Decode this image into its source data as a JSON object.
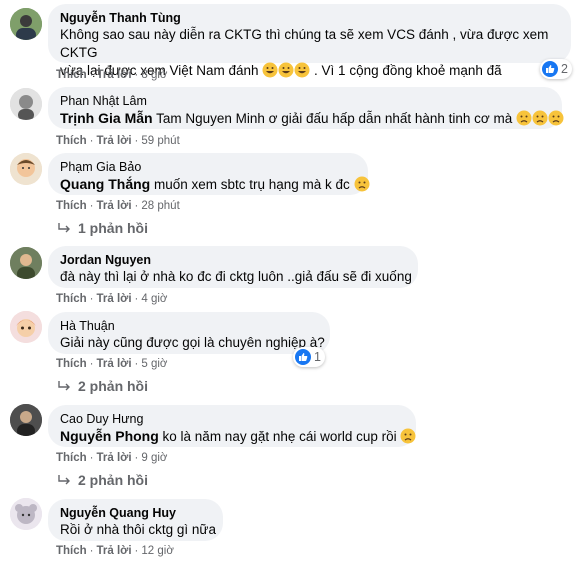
{
  "colors": {
    "bubble": "#f0f2f5",
    "meta": "#65676b",
    "like_blue": "#1877f2"
  },
  "actions": {
    "like": "Thích",
    "reply": "Trả lời"
  },
  "comments": [
    {
      "author": "Nguyễn Thanh Tùng",
      "line1": "Không sao sau này diễn ra CKTG thì chúng ta sẽ xem VCS đánh , vừa được xem CKTG",
      "line2": "vừa lại được xem Việt Nam đánh",
      "line2_after": " . Vì 1 cộng đồng khoẻ mạnh đã",
      "emojis": [
        "grinning",
        "grinning",
        "grinning"
      ],
      "time": "8 giờ",
      "reaction": {
        "icon": "like-icon",
        "count": "2"
      }
    },
    {
      "author": "Phan Nhật Lâm",
      "mention": "Trịnh Gia Mẫn",
      "text": " Tam Nguyen Minh ơ giải đấu hấp dẫn nhất hành tinh cơ mà",
      "emojis": [
        "sad",
        "sad",
        "sad"
      ],
      "time": "59 phút"
    },
    {
      "author": "Phạm Gia Bảo",
      "mention": "Quang Thắng",
      "text": " muốn xem sbtc trụ hạng mà k đc",
      "emojis": [
        "sad"
      ],
      "time": "28 phút",
      "replies": "1 phản hồi"
    },
    {
      "author": "Jordan Nguyen",
      "text": "đà này thì lại ở nhà ko đc đi cktg luôn ..giả đấu sẽ đi xuống",
      "time": "4 giờ"
    },
    {
      "author": "Hà Thuận",
      "text": "Giải này cũng được gọi là chuyên nghiệp à?",
      "time": "5 giờ",
      "reaction": {
        "icon": "like-icon",
        "count": "1"
      },
      "replies": "2 phản hồi"
    },
    {
      "author": "Cao Duy Hưng",
      "mention": "Nguyễn Phong",
      "text": " ko là năm nay gặt nhẹ cái world cup rồi",
      "emojis": [
        "sad"
      ],
      "time": "9 giờ",
      "replies": "2 phản hồi"
    },
    {
      "author": "Nguyễn Quang Huy",
      "text": "Rồi ở nhà thôi cktg gì nữa",
      "time": "12 giờ"
    }
  ]
}
